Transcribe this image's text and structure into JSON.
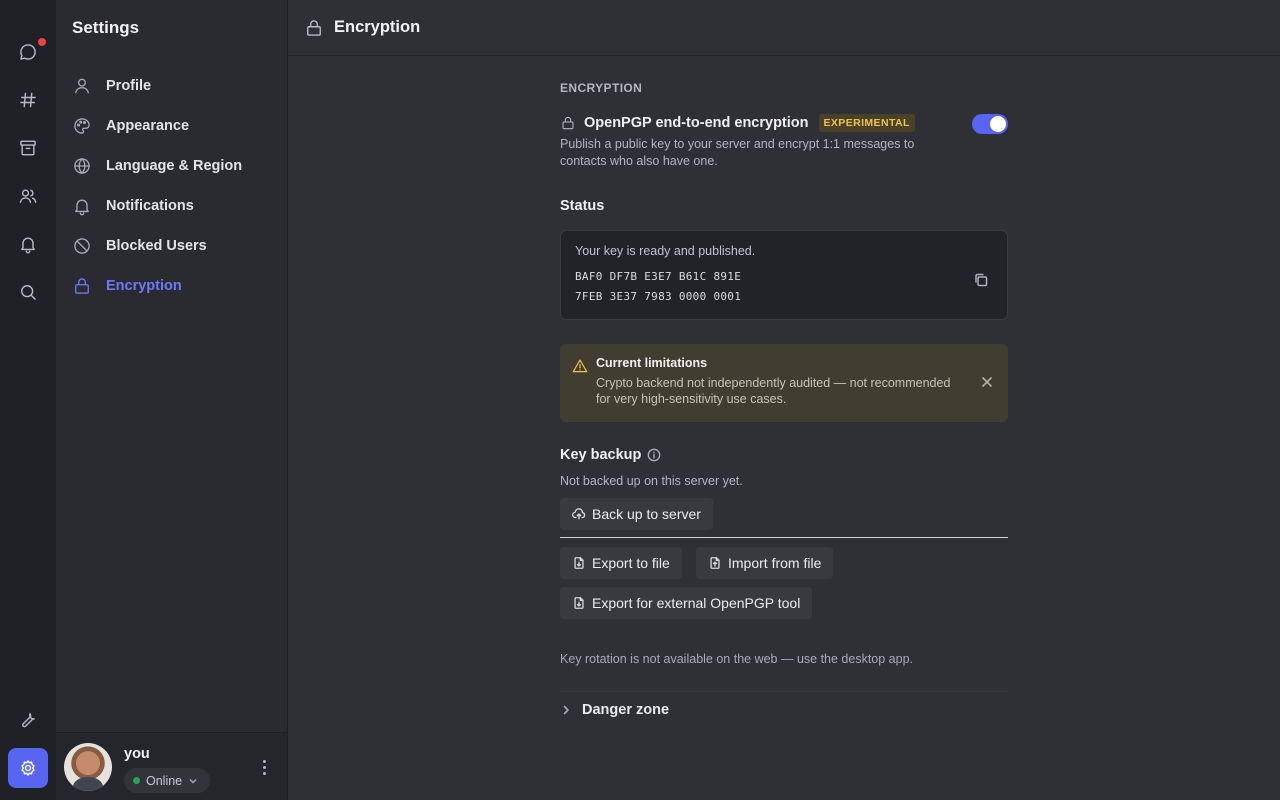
{
  "rail": {
    "items": [
      {
        "icon": "chat-bubble-icon",
        "badge": true
      },
      {
        "icon": "hash-icon"
      },
      {
        "icon": "archive-icon"
      },
      {
        "icon": "users-icon"
      },
      {
        "icon": "bell-icon"
      },
      {
        "icon": "search-icon"
      }
    ],
    "bottom": [
      {
        "icon": "wrench-icon"
      },
      {
        "icon": "gear-icon",
        "active": true
      }
    ]
  },
  "sidebar": {
    "title": "Settings",
    "items": [
      {
        "label": "Profile",
        "icon": "user-icon"
      },
      {
        "label": "Appearance",
        "icon": "palette-icon"
      },
      {
        "label": "Language & Region",
        "icon": "globe-icon"
      },
      {
        "label": "Notifications",
        "icon": "bell-icon"
      },
      {
        "label": "Blocked Users",
        "icon": "blocked-icon"
      },
      {
        "label": "Encryption",
        "icon": "lock-icon",
        "active": true
      }
    ]
  },
  "user": {
    "name": "you",
    "status": "Online",
    "status_color": "#23a55a"
  },
  "header": {
    "title": "Encryption"
  },
  "encryption": {
    "section_label": "ENCRYPTION",
    "pgp_title": "OpenPGP end-to-end encryption",
    "badge": "EXPERIMENTAL",
    "description": "Publish a public key to your server and encrypt 1:1 messages to contacts who also have one.",
    "enabled": true
  },
  "status": {
    "title": "Status",
    "message": "Your key is ready and published.",
    "fingerprint_line1": "BAF0 DF7B E3E7 B61C 891E",
    "fingerprint_line2": "7FEB 3E37 7983 0000 0001"
  },
  "warning": {
    "title": "Current limitations",
    "text": "Crypto backend not independently audited — not recommended for very high-sensitivity use cases."
  },
  "backup": {
    "title": "Key backup",
    "status": "Not backed up on this server yet.",
    "backup_button": "Back up to server",
    "export_button": "Export to file",
    "import_button": "Import from file",
    "export_external_button": "Export for external OpenPGP tool",
    "rotation_note": "Key rotation is not available on the web — use the desktop app."
  },
  "danger_zone": {
    "label": "Danger zone"
  },
  "colors": {
    "accent": "#5865f2",
    "warning": "#f0c543",
    "notification_dot": "#f23f42"
  }
}
